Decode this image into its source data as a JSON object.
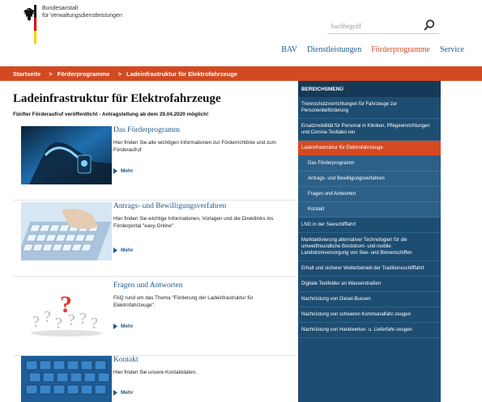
{
  "header": {
    "logo_line1": "Bundesanstalt",
    "logo_line2": "für Verwaltungsdienstleistungen",
    "colors": {
      "black": "#111111",
      "red": "#dd0000",
      "gold": "#ffce00"
    }
  },
  "search": {
    "placeholder": "Suchbegriff"
  },
  "mainnav": {
    "items": [
      {
        "label": "BAV"
      },
      {
        "label": "Dienstleistungen"
      },
      {
        "label": "Förderprogramme"
      },
      {
        "label": "Service"
      }
    ],
    "active_index": 2
  },
  "breadcrumb": {
    "items": [
      {
        "label": "Startseite"
      },
      {
        "label": "Förderprogramme"
      },
      {
        "label": "Ladeinfrastruktur für Elektrofahrzeuge"
      }
    ],
    "separator": ">"
  },
  "main": {
    "title": "Ladeinfrastruktur für Elektrofahrzeuge",
    "subtitle": "Fünfter Förderaufruf veröffentlicht - Antragstellung ab dem 29.04.2020 möglich!",
    "teasers": [
      {
        "title": "Das Förderprogramm",
        "text": "Hier finden Sie alle wichtigen Informationen zur Förderrichtlinie und zum Förderaufruf",
        "more": "Mehr"
      },
      {
        "title": "Antrags- und Bewilligungsverfahren",
        "text": "Hier finden Sie wichtige Informationen, Vorlagen und die Direktlinks ins Förderportal \"easy-Online\"",
        "more": "Mehr"
      },
      {
        "title": "Fragen und Antworten",
        "text": "FAQ rund um das Thema \"Förderung der Ladeinfrastruktur für Elektrofahrzeuge\".",
        "more": "Mehr"
      },
      {
        "title": "Kontakt",
        "text": "Hier finden Sie unsere Kontaktdaten.",
        "more": "Mehr"
      }
    ]
  },
  "sidebar": {
    "heading": "BEREICHSMENÜ",
    "items": [
      {
        "label": "Trennschutzvorrichtungen für Fahrzeuge zur Personenbeförderung",
        "type": "normal"
      },
      {
        "label": "Ersatzmobilität für Personal in Kliniken, Pflegeeinrichtungen und Corona-Testlabo-ren",
        "type": "normal"
      },
      {
        "label": "Ladeinfrastruktur für Elektrofahrzeuge",
        "type": "active"
      },
      {
        "label": "Das Förderprogramm",
        "type": "sub"
      },
      {
        "label": "Antrags- und Bewilligungsverfahren",
        "type": "sub"
      },
      {
        "label": "Fragen und Antworten",
        "type": "sub"
      },
      {
        "label": "Kontakt",
        "type": "sub"
      },
      {
        "label": "LNG in der Seeschifffahrt",
        "type": "normal"
      },
      {
        "label": "Marktaktivierung alternativer Technologien für die umweltfreundliche Bordstrom- und mobile Landstromversorgung von See- und Binnenschiffen",
        "type": "normal"
      },
      {
        "label": "Erhalt und sicherer Weiterbetrieb der Traditionsschifffahrt",
        "type": "normal"
      },
      {
        "label": "Digitale Testfelder an Wasserstraßen",
        "type": "normal"
      },
      {
        "label": "Nachrüstung von Diesel-Bussen",
        "type": "normal"
      },
      {
        "label": "Nachrüstung von schweren Kommunalfahr-zeugen",
        "type": "normal"
      },
      {
        "label": "Nachrüstung von Handwerker- u. Lieferfahr-zeugen",
        "type": "normal"
      }
    ]
  }
}
